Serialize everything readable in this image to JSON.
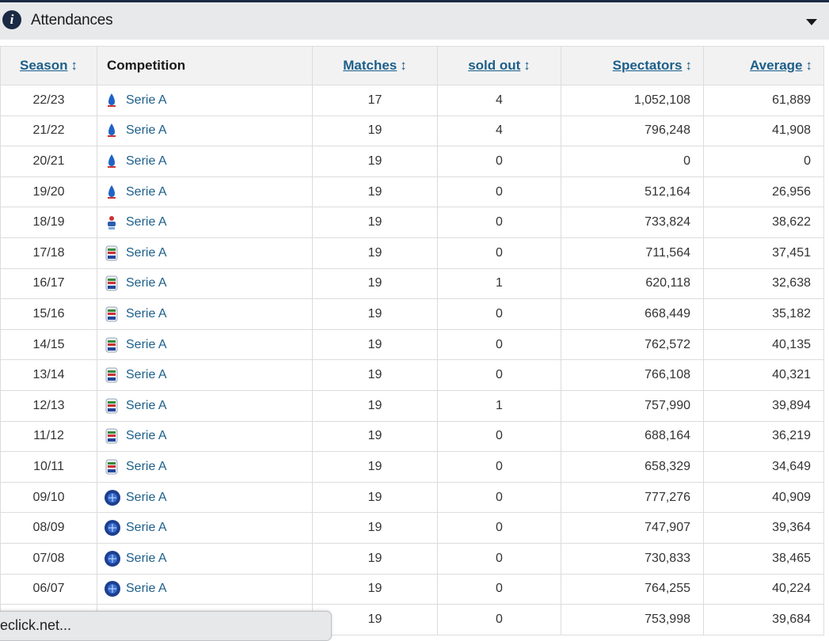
{
  "header": {
    "title": "Attendances"
  },
  "columns": {
    "season": "Season",
    "competition": "Competition",
    "matches": "Matches",
    "sold_out": "sold out",
    "spectators": "Spectators",
    "average": "Average"
  },
  "rows": [
    {
      "season": "22/23",
      "competition": "Serie A",
      "matches": "17",
      "sold_out": "4",
      "spectators": "1,052,108",
      "average": "61,889",
      "logo": "serie-a-2022-logo-icon"
    },
    {
      "season": "21/22",
      "competition": "Serie A",
      "matches": "19",
      "sold_out": "4",
      "spectators": "796,248",
      "average": "41,908",
      "logo": "serie-a-2022-logo-icon"
    },
    {
      "season": "20/21",
      "competition": "Serie A",
      "matches": "19",
      "sold_out": "0",
      "spectators": "0",
      "average": "0",
      "logo": "serie-a-2022-logo-icon"
    },
    {
      "season": "19/20",
      "competition": "Serie A",
      "matches": "19",
      "sold_out": "0",
      "spectators": "512,164",
      "average": "26,956",
      "logo": "serie-a-2022-logo-icon"
    },
    {
      "season": "18/19",
      "competition": "Serie A",
      "matches": "19",
      "sold_out": "0",
      "spectators": "733,824",
      "average": "38,622",
      "logo": "serie-a-2018-logo-icon"
    },
    {
      "season": "17/18",
      "competition": "Serie A",
      "matches": "19",
      "sold_out": "0",
      "spectators": "711,564",
      "average": "37,451",
      "logo": "serie-a-shield-logo-icon"
    },
    {
      "season": "16/17",
      "competition": "Serie A",
      "matches": "19",
      "sold_out": "1",
      "spectators": "620,118",
      "average": "32,638",
      "logo": "serie-a-shield-logo-icon"
    },
    {
      "season": "15/16",
      "competition": "Serie A",
      "matches": "19",
      "sold_out": "0",
      "spectators": "668,449",
      "average": "35,182",
      "logo": "serie-a-shield-logo-icon"
    },
    {
      "season": "14/15",
      "competition": "Serie A",
      "matches": "19",
      "sold_out": "0",
      "spectators": "762,572",
      "average": "40,135",
      "logo": "serie-a-shield-logo-icon"
    },
    {
      "season": "13/14",
      "competition": "Serie A",
      "matches": "19",
      "sold_out": "0",
      "spectators": "766,108",
      "average": "40,321",
      "logo": "serie-a-shield-logo-icon"
    },
    {
      "season": "12/13",
      "competition": "Serie A",
      "matches": "19",
      "sold_out": "1",
      "spectators": "757,990",
      "average": "39,894",
      "logo": "serie-a-shield-logo-icon"
    },
    {
      "season": "11/12",
      "competition": "Serie A",
      "matches": "19",
      "sold_out": "0",
      "spectators": "688,164",
      "average": "36,219",
      "logo": "serie-a-shield-logo-icon"
    },
    {
      "season": "10/11",
      "competition": "Serie A",
      "matches": "19",
      "sold_out": "0",
      "spectators": "658,329",
      "average": "34,649",
      "logo": "serie-a-shield-logo-icon"
    },
    {
      "season": "09/10",
      "competition": "Serie A",
      "matches": "19",
      "sold_out": "0",
      "spectators": "777,276",
      "average": "40,909",
      "logo": "serie-a-globe-logo-icon"
    },
    {
      "season": "08/09",
      "competition": "Serie A",
      "matches": "19",
      "sold_out": "0",
      "spectators": "747,907",
      "average": "39,364",
      "logo": "serie-a-globe-logo-icon"
    },
    {
      "season": "07/08",
      "competition": "Serie A",
      "matches": "19",
      "sold_out": "0",
      "spectators": "730,833",
      "average": "38,465",
      "logo": "serie-a-globe-logo-icon"
    },
    {
      "season": "06/07",
      "competition": "Serie A",
      "matches": "19",
      "sold_out": "0",
      "spectators": "764,255",
      "average": "40,224",
      "logo": "serie-a-globe-logo-icon"
    },
    {
      "season": "",
      "competition": "",
      "matches": "19",
      "sold_out": "0",
      "spectators": "753,998",
      "average": "39,684",
      "logo": "serie-a-globe-logo-icon"
    }
  ],
  "statusbar": {
    "text": "eclick.net..."
  },
  "colors": {
    "link": "#1d5f8a",
    "header_bg": "#e8e9eb",
    "navy": "#1a2a44"
  }
}
